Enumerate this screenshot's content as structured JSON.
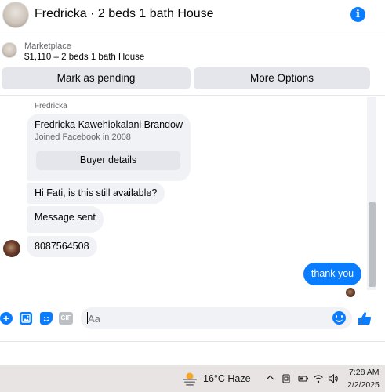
{
  "header": {
    "title": "Fredricka · 2 beds 1 bath House",
    "info_icon": "info-icon"
  },
  "listing": {
    "label": "Marketplace",
    "summary": "$1,110 – 2 beds 1 bath House",
    "mark_pending_label": "Mark as pending",
    "more_options_label": "More Options"
  },
  "conversation": {
    "sender_name": "Fredricka",
    "profile_card": {
      "full_name": "Fredricka Kawehiokalani Brandow",
      "joined": "Joined Facebook in 2008",
      "button_label": "Buyer details"
    },
    "incoming": [
      "Hi Fati, is this still available?",
      "Message sent",
      "8087564508"
    ],
    "outgoing": [
      "thank you"
    ]
  },
  "composer": {
    "placeholder": "Aa",
    "value": "",
    "gif_label": "GIF",
    "icons": [
      "plus-icon",
      "photo-icon",
      "sticker-icon",
      "gif-icon",
      "emoji-icon",
      "thumbs-up-icon"
    ]
  },
  "taskbar": {
    "weather": "16°C  Haze",
    "time": "7:28 AM",
    "date": "2/2/2025"
  },
  "colors": {
    "accent": "#0a7cff",
    "bubble_gray": "#f0f2f5",
    "button_gray": "#e4e6eb"
  }
}
